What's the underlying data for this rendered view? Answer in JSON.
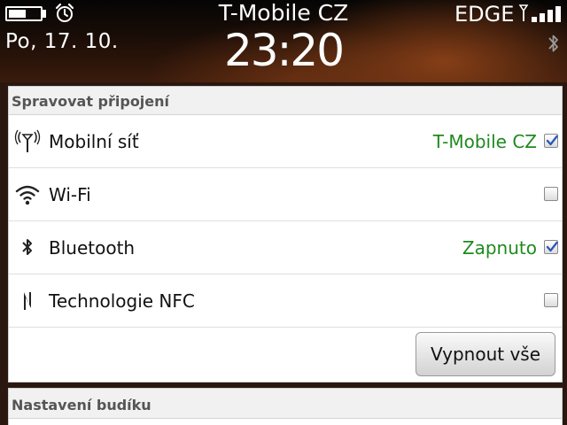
{
  "status_bar": {
    "date": "Po, 17. 10.",
    "carrier": "T-Mobile CZ",
    "time": "23:20",
    "network_type": "EDGE",
    "battery_level": 0.55
  },
  "connections": {
    "title": "Spravovat připojení",
    "items": [
      {
        "label": "Mobilní síť",
        "status": "T-Mobile CZ",
        "checked": true,
        "icon": "antenna-icon"
      },
      {
        "label": "Wi-Fi",
        "status": "",
        "checked": false,
        "icon": "wifi-icon"
      },
      {
        "label": "Bluetooth",
        "status": "Zapnuto",
        "checked": true,
        "icon": "bluetooth-icon"
      },
      {
        "label": "Technologie NFC",
        "status": "",
        "checked": false,
        "icon": "nfc-icon"
      }
    ],
    "turn_off_all_label": "Vypnout vše"
  },
  "alarm": {
    "title": "Nastavení budíku"
  },
  "colors": {
    "status_green": "#1f8a1f",
    "header_gray": "#555555"
  }
}
